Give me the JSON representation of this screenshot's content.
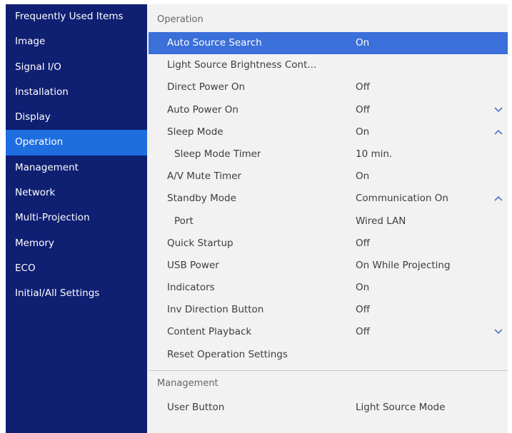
{
  "sidebar": {
    "items": [
      {
        "label": "Frequently Used Items",
        "selected": false
      },
      {
        "label": "Image",
        "selected": false
      },
      {
        "label": "Signal I/O",
        "selected": false
      },
      {
        "label": "Installation",
        "selected": false
      },
      {
        "label": "Display",
        "selected": false
      },
      {
        "label": "Operation",
        "selected": true
      },
      {
        "label": "Management",
        "selected": false
      },
      {
        "label": "Network",
        "selected": false
      },
      {
        "label": "Multi-Projection",
        "selected": false
      },
      {
        "label": "Memory",
        "selected": false
      },
      {
        "label": "ECO",
        "selected": false
      },
      {
        "label": "Initial/All Settings",
        "selected": false
      }
    ]
  },
  "main": {
    "operation_header": "Operation",
    "operation_rows": [
      {
        "label": "Auto Source Search",
        "value": "On",
        "selected": true,
        "indent": false,
        "chevron": ""
      },
      {
        "label": "Light Source Brightness Cont...",
        "value": "",
        "selected": false,
        "indent": false,
        "chevron": ""
      },
      {
        "label": "Direct Power On",
        "value": "Off",
        "selected": false,
        "indent": false,
        "chevron": ""
      },
      {
        "label": "Auto Power On",
        "value": "Off",
        "selected": false,
        "indent": false,
        "chevron": "down"
      },
      {
        "label": "Sleep Mode",
        "value": "On",
        "selected": false,
        "indent": false,
        "chevron": "up"
      },
      {
        "label": "Sleep Mode Timer",
        "value": "10 min.",
        "selected": false,
        "indent": true,
        "chevron": ""
      },
      {
        "label": "A/V Mute Timer",
        "value": "On",
        "selected": false,
        "indent": false,
        "chevron": ""
      },
      {
        "label": "Standby Mode",
        "value": "Communication On",
        "selected": false,
        "indent": false,
        "chevron": "up"
      },
      {
        "label": "Port",
        "value": "Wired LAN",
        "selected": false,
        "indent": true,
        "chevron": ""
      },
      {
        "label": "Quick Startup",
        "value": "Off",
        "selected": false,
        "indent": false,
        "chevron": ""
      },
      {
        "label": "USB Power",
        "value": "On While Projecting",
        "selected": false,
        "indent": false,
        "chevron": ""
      },
      {
        "label": "Indicators",
        "value": "On",
        "selected": false,
        "indent": false,
        "chevron": ""
      },
      {
        "label": "Inv Direction Button",
        "value": "Off",
        "selected": false,
        "indent": false,
        "chevron": ""
      },
      {
        "label": "Content Playback",
        "value": "Off",
        "selected": false,
        "indent": false,
        "chevron": "down"
      },
      {
        "label": "Reset Operation Settings",
        "value": "",
        "selected": false,
        "indent": false,
        "chevron": ""
      }
    ],
    "management_header": "Management",
    "management_rows": [
      {
        "label": "User Button",
        "value": "Light Source Mode",
        "selected": false,
        "indent": false,
        "chevron": ""
      }
    ]
  },
  "icons": {
    "chevron_up": "chevron-up-icon",
    "chevron_down": "chevron-down-icon"
  },
  "colors": {
    "sidebar_bg": "#0f1f72",
    "sidebar_selected": "#1f6ee0",
    "row_selected": "#3b6fd9",
    "panel_bg": "#f2f2f2",
    "chevron": "#5a6fc8"
  }
}
